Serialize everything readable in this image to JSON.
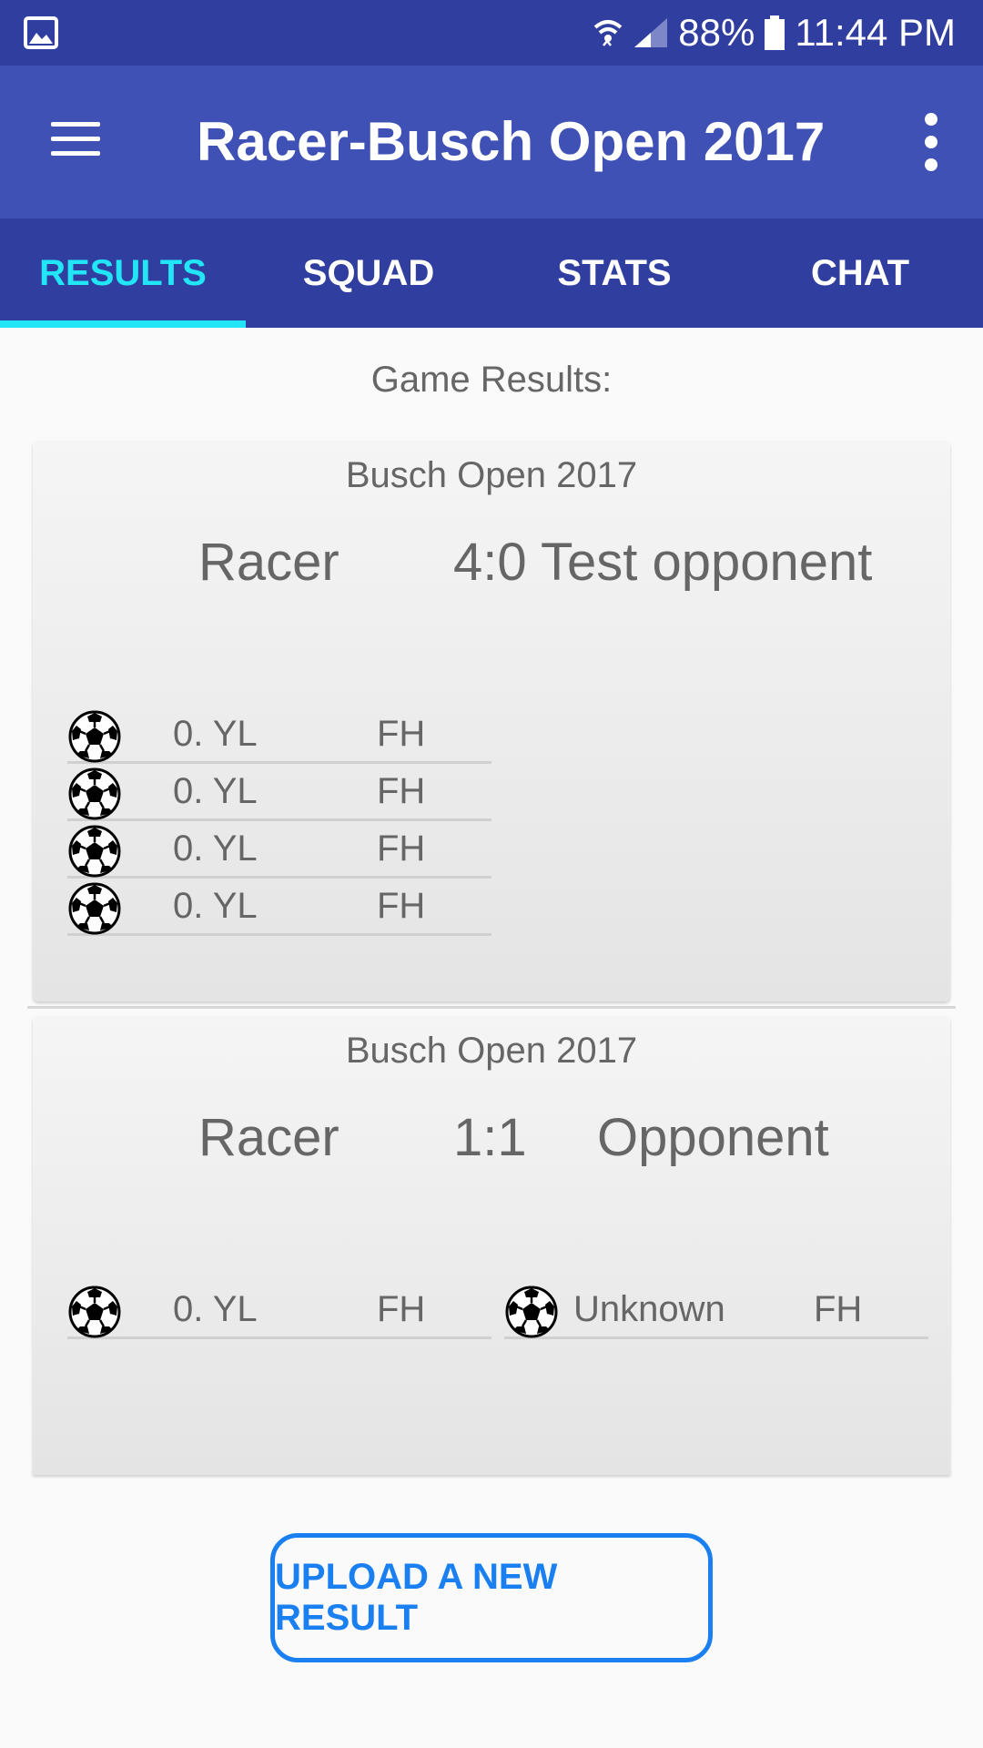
{
  "status_bar": {
    "battery": "88%",
    "time": "11:44 PM"
  },
  "app_bar": {
    "title": "Racer-Busch Open 2017"
  },
  "tabs": [
    {
      "label": "RESULTS",
      "active": true
    },
    {
      "label": "SQUAD",
      "active": false
    },
    {
      "label": "STATS",
      "active": false
    },
    {
      "label": "CHAT",
      "active": false
    }
  ],
  "section_title": "Game Results:",
  "games": [
    {
      "league": "Busch Open 2017",
      "home": "Racer",
      "score": "4:0",
      "away": "Test opponent",
      "home_events": [
        {
          "player": "0. YL",
          "half": "FH"
        },
        {
          "player": "0. YL",
          "half": "FH"
        },
        {
          "player": "0. YL",
          "half": "FH"
        },
        {
          "player": "0. YL",
          "half": "FH"
        }
      ],
      "away_events": []
    },
    {
      "league": "Busch Open 2017",
      "home": "Racer",
      "score": "1:1",
      "away": "Opponent",
      "home_events": [
        {
          "player": "0. YL",
          "half": "FH"
        }
      ],
      "away_events": [
        {
          "player": "Unknown",
          "half": "FH"
        }
      ]
    }
  ],
  "upload_button": "UPLOAD A NEW RESULT",
  "colors": {
    "status_bar": "#303f9f",
    "app_bar": "#3f51b5",
    "tab_indicator": "#22e5f5",
    "button_accent": "#1a7ff0"
  },
  "icons": {
    "notification": "image-icon",
    "wifi": "wifi-icon",
    "signal": "signal-icon",
    "battery": "battery-icon",
    "menu": "menu-icon",
    "overflow": "more-vert-icon",
    "goal": "soccer-ball-icon"
  }
}
